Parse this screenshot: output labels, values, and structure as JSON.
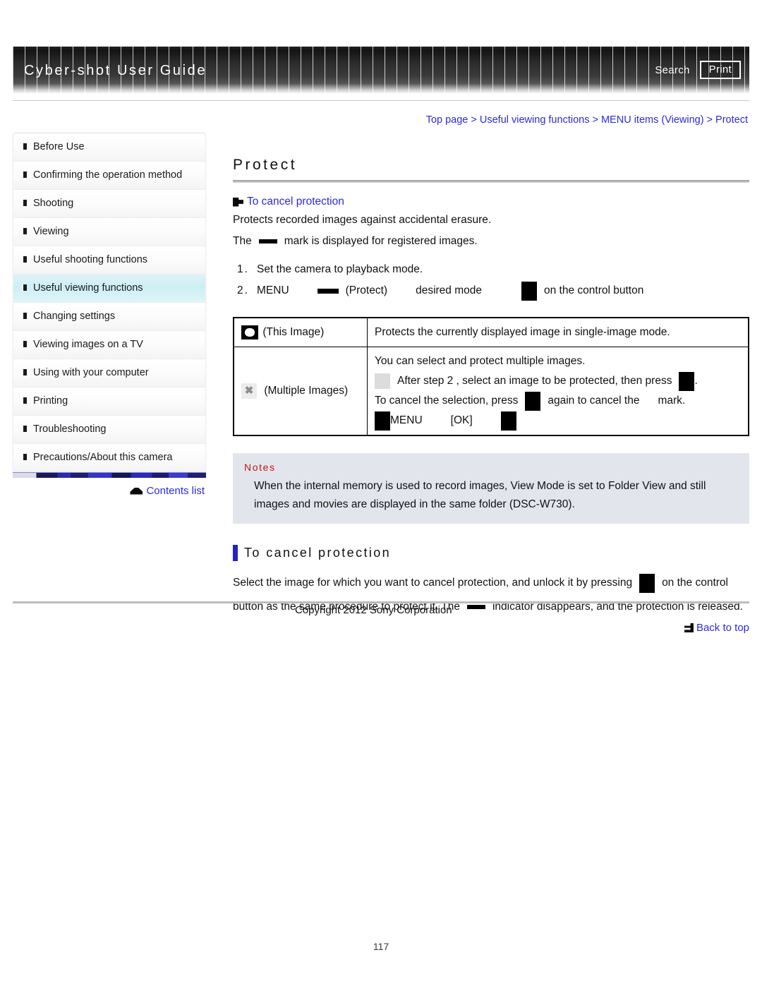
{
  "header": {
    "title": "Cyber-shot User Guide",
    "search_label": "Search",
    "print_label": "Print"
  },
  "sidebar": {
    "items": [
      {
        "label": "Before Use",
        "active": false
      },
      {
        "label": "Confirming the operation method",
        "active": false
      },
      {
        "label": "Shooting",
        "active": false
      },
      {
        "label": "Viewing",
        "active": false
      },
      {
        "label": "Useful shooting functions",
        "active": false
      },
      {
        "label": "Useful viewing functions",
        "active": true
      },
      {
        "label": "Changing settings",
        "active": false
      },
      {
        "label": "Viewing images on a TV",
        "active": false
      },
      {
        "label": "Using with your computer",
        "active": false
      },
      {
        "label": "Printing",
        "active": false
      },
      {
        "label": "Troubleshooting",
        "active": false
      },
      {
        "label": "Precautions/About this camera",
        "active": false
      }
    ],
    "contents_list_label": "Contents list"
  },
  "main": {
    "breadcrumb": "Top page > Useful viewing functions > MENU items (Viewing) > Protect",
    "page_title": "Protect",
    "jump_link": "To cancel protection",
    "intro_line1": "Protects recorded images against accidental erasure.",
    "intro_line2_pre": "The",
    "intro_line2_post": "mark is displayed for registered images.",
    "steps": [
      {
        "num": "1.",
        "text": "Set the camera to playback mode."
      },
      {
        "num": "2.",
        "part1": "MENU",
        "part2": "(Protect)",
        "part3": "desired mode",
        "part4": "on the control button"
      }
    ],
    "table": {
      "rows": [
        {
          "icon": "this-image-icon",
          "label": "(This Image)",
          "lines": [
            {
              "text": "Protects the currently displayed image in single-image mode."
            }
          ]
        },
        {
          "icon": "multiple-images-icon",
          "icon_glyph": "✖",
          "label": "(Multiple Images)",
          "lines": [
            {
              "text": "You can select and protect multiple images."
            },
            {
              "pre": "After step 2 , select an image to be protected, then press",
              "post": "."
            },
            {
              "pre": "To cancel the selection, press",
              "mid": "again to cancel the",
              "post": "mark."
            },
            {
              "pre": "MENU",
              "mid": "[OK]"
            }
          ]
        }
      ]
    },
    "notes": {
      "heading": "Notes",
      "body": "When the internal memory is used to record images, View Mode is set to Folder View and still images and movies are displayed in the same folder (DSC-W730)."
    },
    "subsection": {
      "title": "To cancel protection",
      "line1_pre": "Select the image for which you want to cancel protection, and unlock it by pressing",
      "line1_post": "on the control",
      "line2_pre": "button as the same procedure to protect it. The",
      "line2_post": "indicator disappears, and the protection is released."
    },
    "back_to_top_label": "Back to top"
  },
  "footer": {
    "copyright": "Copyright 2012 Sony Corporation",
    "page_number": "117"
  },
  "colors": {
    "link": "#2a2ae0",
    "notes_heading": "#cc1111",
    "active_nav": "#cdeef5",
    "accent_bar": "#2222cc"
  }
}
